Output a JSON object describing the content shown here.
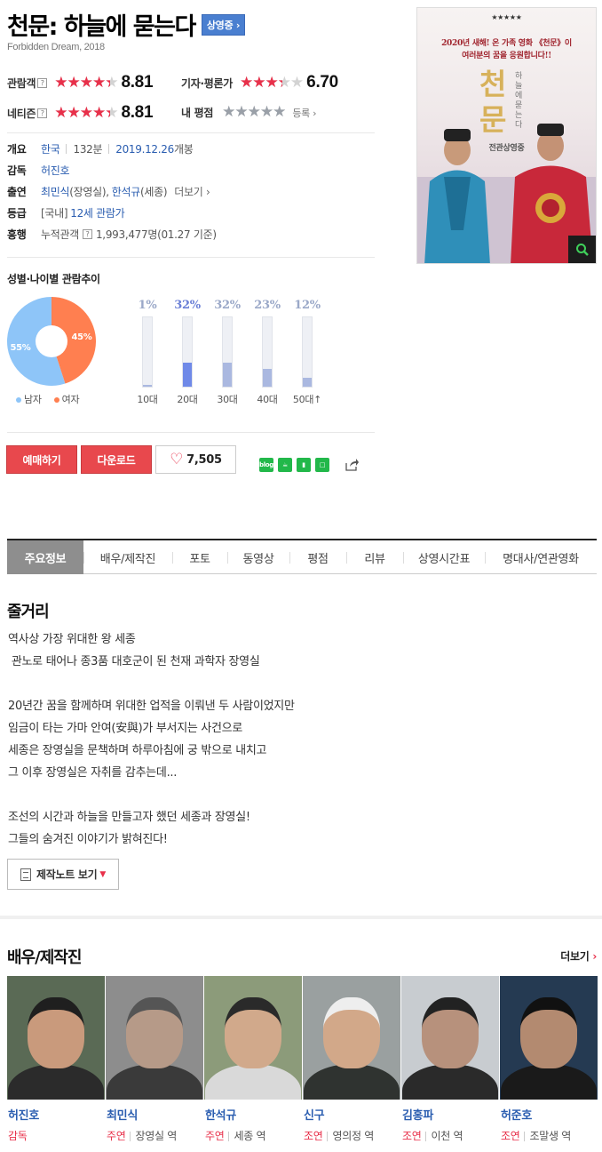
{
  "movie": {
    "title": "천문: 하늘에 묻는다",
    "status_badge": "상영중 ›",
    "subtitle": "Forbidden Dream, 2018"
  },
  "ratings": {
    "audience": {
      "label": "관람객",
      "help": "?",
      "score": "8.81",
      "fill": 0.881
    },
    "critic": {
      "label": "기자·평론가",
      "score": "6.70",
      "fill": 0.67
    },
    "netizen": {
      "label": "네티즌",
      "help": "?",
      "score": "8.81",
      "fill": 0.881
    },
    "mine": {
      "label": "내 평점",
      "fill": 1.0,
      "register": "등록 ›"
    }
  },
  "info": {
    "overview_label": "개요",
    "country": "한국",
    "runtime": "132분",
    "release_date": "2019.12.26",
    "release_suffix": "개봉",
    "director_label": "감독",
    "director": "허진호",
    "cast_label": "출연",
    "cast1": "최민식",
    "cast1_role": "(장영실),",
    "cast2": "한석규",
    "cast2_role": "(세종)",
    "cast_more": "더보기 ›",
    "grade_label": "등급",
    "grade_prefix": "[국내]",
    "grade": "12세 관람가",
    "boxoffice_label": "흥행",
    "boxoffice_key": "누적관객",
    "boxoffice_help": "?",
    "boxoffice_value": "1,993,477명",
    "boxoffice_date": "(01.27 기준)"
  },
  "stats": {
    "title": "성별·나이별 관람추이",
    "gender": {
      "male_label": "남자",
      "female_label": "여자",
      "male_pct": 55,
      "female_pct": 45,
      "male_text": "55%",
      "female_text": "45%",
      "male_color": "#8ec5f8",
      "female_color": "#ff7f50"
    },
    "ages": [
      {
        "label": "10대",
        "pct_text": "1%",
        "value": 1
      },
      {
        "label": "20대",
        "pct_text": "32%",
        "value": 32
      },
      {
        "label": "30대",
        "pct_text": "32%",
        "value": 32
      },
      {
        "label": "40대",
        "pct_text": "23%",
        "value": 23
      },
      {
        "label": "50대↑",
        "pct_text": "12%",
        "value": 12
      }
    ]
  },
  "actions": {
    "reserve": "예매하기",
    "download": "다운로드",
    "likes": "7,505",
    "share_icons": [
      "blog-icon",
      "cafe-icon",
      "bookmark-icon",
      "memo-icon",
      "share-icon"
    ]
  },
  "tabs": [
    "주요정보",
    "배우/제작진",
    "포토",
    "동영상",
    "평점",
    "리뷰",
    "상영시간표",
    "명대사/연관영화"
  ],
  "synopsis": {
    "heading": "줄거리",
    "lines": [
      "역사상 가장 위대한 왕 세종",
      " 관노로 태어나 종3품 대호군이 된 천재 과학자 장영실",
      "",
      "20년간 꿈을 함께하며 위대한 업적을 이뤄낸 두 사람이었지만",
      "임금이 타는 가마 안여(安與)가 부서지는 사건으로",
      "세종은 장영실을 문책하며 하루아침에 궁 밖으로 내치고",
      "그 이후 장영실은 자취를 감추는데...",
      "",
      "조선의 시간과 하늘을 만들고자 했던 세종과 장영실!",
      "그들의 숨겨진 이야기가 밝혀진다!"
    ],
    "note_button": "제작노트 보기"
  },
  "cast_section": {
    "heading": "배우/제작진",
    "more": "더보기",
    "people": [
      {
        "name": "허진호",
        "role": "감독",
        "character": ""
      },
      {
        "name": "최민식",
        "role": "주연",
        "character": "장영실 역"
      },
      {
        "name": "한석규",
        "role": "주연",
        "character": "세종 역"
      },
      {
        "name": "신구",
        "role": "조연",
        "character": "영의정 역"
      },
      {
        "name": "김홍파",
        "role": "조연",
        "character": "이천 역"
      },
      {
        "name": "허준호",
        "role": "조연",
        "character": "조말생 역"
      }
    ]
  },
  "poster": {
    "stars": "★★★★★",
    "tagline": "2020년 새해! 온 가족 영화 《천문》이\n여러분의 꿈을 응원합니다!!",
    "title_chars": "천문",
    "sub": "하늘에 묻는다",
    "now_showing": "전관상영중",
    "zoom_icon": "search-icon"
  }
}
